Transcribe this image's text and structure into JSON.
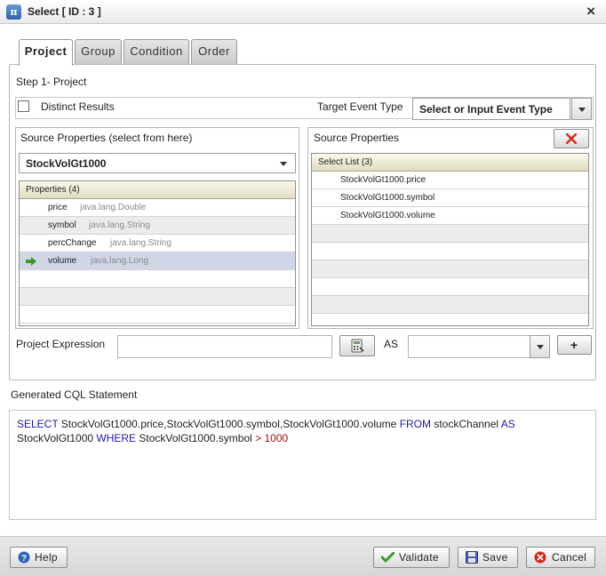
{
  "window": {
    "title": "Select [ ID : 3 ]",
    "app_icon": "π"
  },
  "tabs": [
    {
      "label": "Project",
      "active": true
    },
    {
      "label": "Group",
      "active": false
    },
    {
      "label": "Condition",
      "active": false
    },
    {
      "label": "Order",
      "active": false
    }
  ],
  "step": {
    "label": "Step 1- Project"
  },
  "distinct": {
    "label": "Distinct Results",
    "checked": false
  },
  "target_event": {
    "label": "Target Event Type",
    "placeholder": "Select or Input Event Type"
  },
  "source_left": {
    "title": "Source Properties (select from here)",
    "selected_source": "StockVolGt1000",
    "header": "Properties (4)",
    "properties": [
      {
        "name": "price",
        "type": "java.lang.Double",
        "selected": false
      },
      {
        "name": "symbol",
        "type": "java.lang.String",
        "selected": false
      },
      {
        "name": "percChange",
        "type": "java.lang.String",
        "selected": false
      },
      {
        "name": "volume",
        "type": "java.lang.Long",
        "selected": true
      }
    ]
  },
  "source_right": {
    "title": "Source Properties",
    "header": "Select List (3)",
    "items": [
      "StockVolGt1000.price",
      "StockVolGt1000.symbol",
      "StockVolGt1000.volume"
    ]
  },
  "project_expression": {
    "label": "Project Expression",
    "value": "",
    "as_label": "AS",
    "alias": "",
    "add_label": "+"
  },
  "generated": {
    "label": "Generated CQL Statement",
    "tokens": [
      {
        "t": "SELECT",
        "k": "kw"
      },
      {
        "t": " StockVolGt1000.price,StockVolGt1000.symbol,StockVolGt1000.volume ",
        "k": ""
      },
      {
        "t": "FROM",
        "k": "kw"
      },
      {
        "t": " stockChannel ",
        "k": ""
      },
      {
        "t": "AS",
        "k": "kw"
      },
      {
        "t": " StockVolGt1000 ",
        "k": ""
      },
      {
        "t": "WHERE",
        "k": "kw"
      },
      {
        "t": " StockVolGt1000.symbol ",
        "k": ""
      },
      {
        "t": ">",
        "k": "num"
      },
      {
        "t": " ",
        "k": ""
      },
      {
        "t": "1000",
        "k": "num"
      }
    ]
  },
  "footer": {
    "help": "Help",
    "validate": "Validate",
    "save": "Save",
    "cancel": "Cancel"
  },
  "colors": {
    "keyword": "#1d1aa8",
    "number": "#a01010",
    "accent_red": "#d12a1a",
    "accent_green": "#3a9a2a"
  }
}
